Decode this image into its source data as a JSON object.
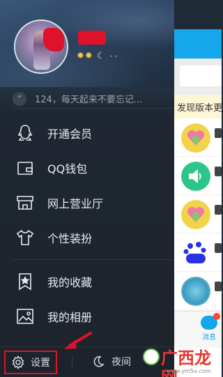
{
  "profile": {
    "level_badges": "✹✹",
    "level_moon": "☾",
    "level_dots": "••"
  },
  "signature": {
    "quote_glyph": "“",
    "text": "124，每天起来不要忘记..."
  },
  "menu": {
    "items": [
      {
        "label": "开通会员",
        "icon": "penguin-icon"
      },
      {
        "label": "QQ钱包",
        "icon": "wallet-icon"
      },
      {
        "label": "网上营业厅",
        "icon": "storefront-icon"
      },
      {
        "label": "个性装扮",
        "icon": "tshirt-icon"
      },
      {
        "label": "我的收藏",
        "icon": "bookmark-star-icon"
      },
      {
        "label": "我的相册",
        "icon": "photo-icon"
      }
    ]
  },
  "bottom": {
    "settings_label": "设置",
    "night_label": "夜间"
  },
  "main": {
    "notice_text": "发现版本更",
    "tab_label": "消息"
  },
  "watermark": {
    "text": "广西龙网",
    "url": "www.ym5u.com"
  },
  "colors": {
    "annotation_red": "#e0122b",
    "qq_blue": "#16a6ec",
    "drawer_bg": "#1d232b"
  }
}
